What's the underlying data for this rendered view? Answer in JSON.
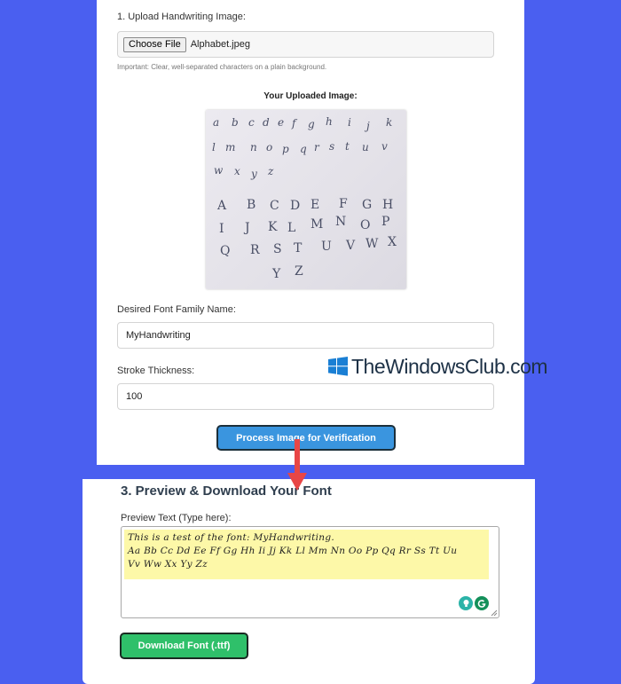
{
  "upload": {
    "label": "1. Upload Handwriting Image:",
    "button_label": "Choose File",
    "file_name": "Alphabet.jpeg",
    "note": "Important: Clear, well-separated characters on a plain background.",
    "image_heading": "Your Uploaded Image:"
  },
  "font_family": {
    "label": "Desired Font Family Name:",
    "value": "MyHandwriting"
  },
  "stroke": {
    "label": "Stroke Thickness:",
    "value": "100"
  },
  "process_button": "Process Image for Verification",
  "watermark": "TheWindowsClub.com",
  "preview_section": {
    "title": "3. Preview & Download Your Font",
    "label": "Preview Text (Type here):",
    "lines": [
      "This is a test of the font: MyHandwriting.",
      "Aa Bb Cc Dd Ee Ff Gg Hh Ii Jj Kk Ll Mm Nn Oo Pp Qq Rr Ss Tt Uu",
      "Vv Ww Xx Yy Zz"
    ]
  },
  "download_button": "Download Font (.ttf)",
  "colors": {
    "background": "#4a5ff0",
    "process_button": "#3a95df",
    "download_button": "#2fc06a",
    "highlight": "#fdf8a8",
    "arrow": "#e84646"
  }
}
